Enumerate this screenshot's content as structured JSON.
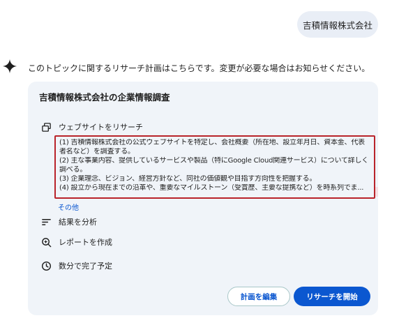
{
  "user_message": "吉積情報株式会社",
  "response": {
    "text": "このトピックに関するリサーチ計画はこちらです。変更が必要な場合はお知らせください。"
  },
  "plan": {
    "title": "吉積情報株式会社の企業情報調査",
    "steps": [
      {
        "label": "ウェブサイトをリサーチ",
        "icon": "web-search-icon"
      },
      {
        "label": "結果を分析",
        "icon": "analyze-icon"
      },
      {
        "label": "レポートを作成",
        "icon": "report-icon"
      },
      {
        "label": "数分で完了予定",
        "icon": "clock-icon"
      }
    ],
    "details": [
      "(1) 吉積情報株式会社の公式ウェブサイトを特定し、会社概要（所在地、設立年月日、資本金、代表",
      "者名など）を調査する。",
      "(2) 主な事業内容、提供しているサービスや製品（特にGoogle Cloud関連サービス）について詳しく",
      "調べる。",
      "(3) 企業理念、ビジョン、経営方針など、同社の価値観や目指す方向性を把握する。",
      "(4) 設立から現在までの沿革や、重要なマイルストーン（受賞歴、主要な提携など）を時系列でま..."
    ],
    "more_label": "その他"
  },
  "buttons": {
    "edit_label": "計画を編集",
    "start_label": "リサーチを開始"
  },
  "colors": {
    "primary": "#0b57d0",
    "card_bg": "#f0f4f9",
    "user_bubble_bg": "#e9eef6",
    "highlight_border": "#b9232a"
  }
}
